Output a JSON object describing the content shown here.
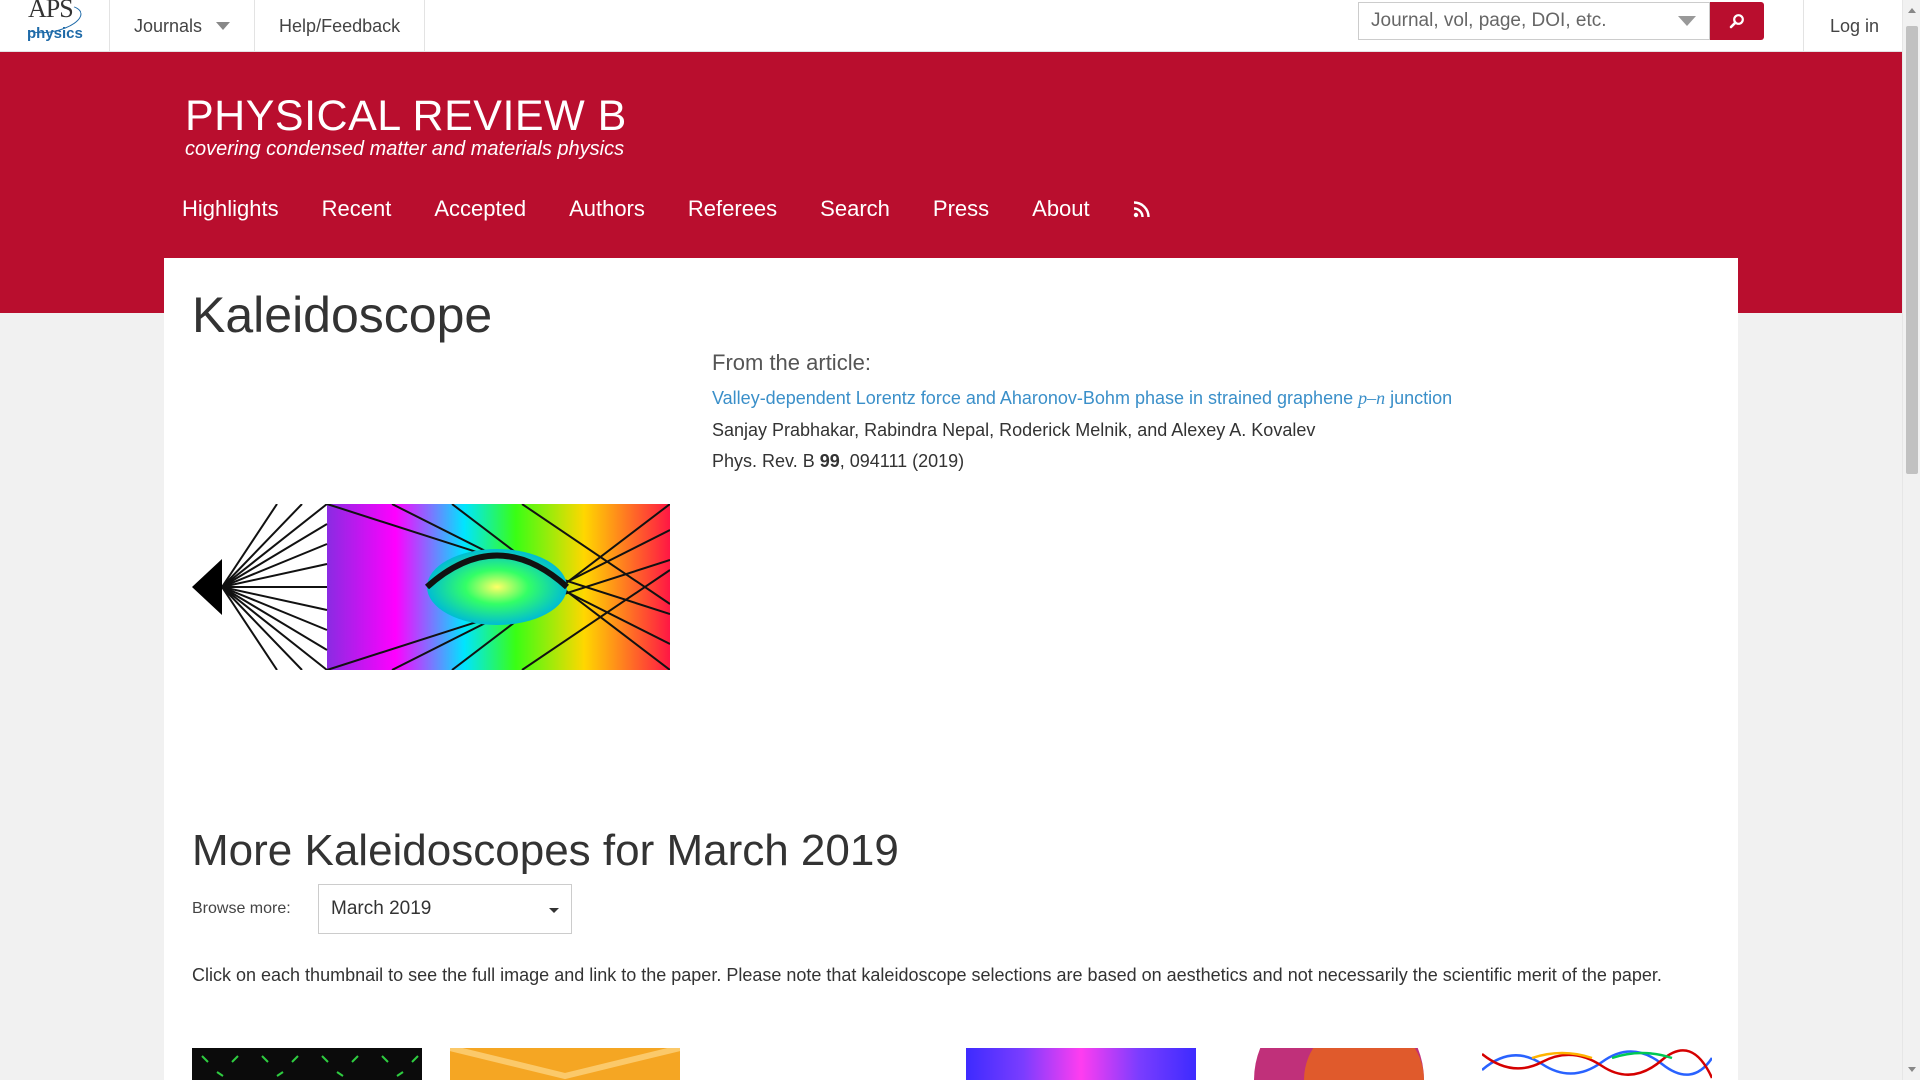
{
  "topbar": {
    "logo_text": "APS",
    "logo_sub": "physics",
    "journals_label": "Journals",
    "help_label": "Help/Feedback",
    "search_placeholder": "Journal, vol, page, DOI, etc.",
    "login_label": "Log in"
  },
  "banner": {
    "title": "PHYSICAL REVIEW B",
    "subtitle": "covering condensed matter and materials physics",
    "nav": [
      "Highlights",
      "Recent",
      "Accepted",
      "Authors",
      "Referees",
      "Search",
      "Press",
      "About"
    ]
  },
  "main": {
    "page_title": "Kaleidoscope",
    "from_label": "From the article:",
    "article_title_pre": "Valley-dependent Lorentz force and Aharonov-Bohm phase in strained graphene ",
    "article_title_math": "p–n",
    "article_title_post": " junction",
    "authors": "Sanjay Prabhakar, Rabindra Nepal, Roderick Melnik, and Alexey A. Kovalev",
    "citation_pre": "Phys. Rev. B ",
    "citation_volume": "99",
    "citation_post": ", 094111 (2019)",
    "more_title": "More Kaleidoscopes for March 2019",
    "browse_label": "Browse more:",
    "browse_value": "March 2019",
    "note": "Click on each thumbnail to see the full image and link to the paper. Please note that kaleidoscope selections are based on aesthetics and not necessarily the scientific merit of the paper."
  },
  "colors": {
    "brand_red": "#b90e2e",
    "link_blue": "#3a8fc9"
  },
  "icons": {
    "search": "magnifier-icon",
    "rss": "rss-icon",
    "dropdown": "chevron-down-icon"
  }
}
